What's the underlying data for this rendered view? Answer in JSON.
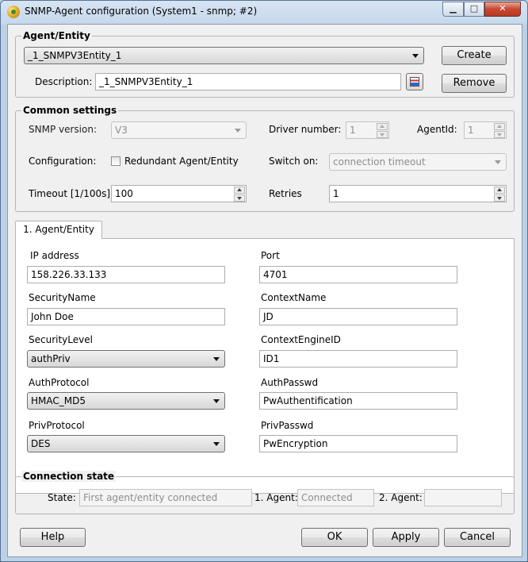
{
  "window": {
    "title": "SNMP-Agent configuration (System1 - snmp; #2)"
  },
  "agent_entity": {
    "legend": "Agent/Entity",
    "selected": "_1_SNMPV3Entity_1",
    "create_label": "Create",
    "description_label": "Description:",
    "description_value": "_1_SNMPV3Entity_1",
    "remove_label": "Remove"
  },
  "common": {
    "legend": "Common settings",
    "snmp_version_label": "SNMP version:",
    "snmp_version_value": "V3",
    "driver_number_label": "Driver number:",
    "driver_number_value": "1",
    "agent_id_label": "AgentId:",
    "agent_id_value": "1",
    "configuration_label": "Configuration:",
    "redundant_label": "Redundant Agent/Entity",
    "switch_on_label": "Switch on:",
    "switch_on_value": "connection timeout",
    "timeout_label": "Timeout [1/100s]",
    "timeout_value": "100",
    "retries_label": "Retries",
    "retries_value": "1"
  },
  "tab": {
    "label": "1. Agent/Entity",
    "ip_label": "IP address",
    "ip_value": "158.226.33.133",
    "port_label": "Port",
    "port_value": "4701",
    "security_name_label": "SecurityName",
    "security_name_value": "John Doe",
    "context_name_label": "ContextName",
    "context_name_value": "JD",
    "security_level_label": "SecurityLevel",
    "security_level_value": "authPriv",
    "context_engine_label": "ContextEngineID",
    "context_engine_value": "ID1",
    "auth_protocol_label": "AuthProtocol",
    "auth_protocol_value": "HMAC_MD5",
    "auth_passwd_label": "AuthPasswd",
    "auth_passwd_value": "PwAuthentification",
    "priv_protocol_label": "PrivProtocol",
    "priv_protocol_value": "DES",
    "priv_passwd_label": "PrivPasswd",
    "priv_passwd_value": "PwEncryption"
  },
  "connection": {
    "legend": "Connection state",
    "state_label": "State:",
    "state_value": "First agent/entity connected",
    "agent1_label": "1. Agent:",
    "agent1_value": "Connected",
    "agent2_label": "2. Agent:",
    "agent2_value": ""
  },
  "footer": {
    "help_label": "Help",
    "ok_label": "OK",
    "apply_label": "Apply",
    "cancel_label": "Cancel"
  }
}
